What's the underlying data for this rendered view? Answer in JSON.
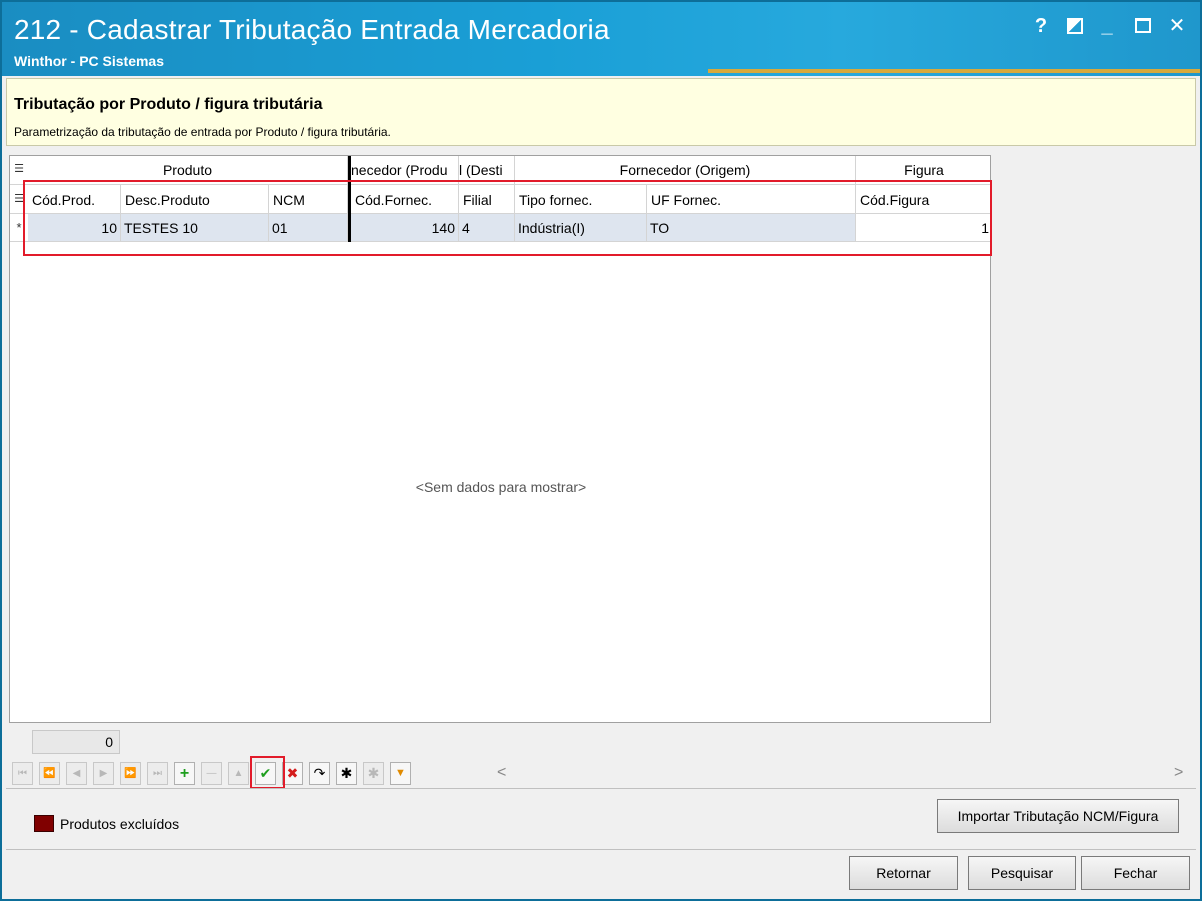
{
  "window": {
    "title": "212 - Cadastrar Tributação Entrada Mercadoria",
    "subtitle": "Winthor - PC Sistemas",
    "controls": {
      "help": "?",
      "minimize": "_",
      "close": "✕"
    }
  },
  "info": {
    "title": "Tributação por Produto / figura tributária",
    "description": "Parametrização da tributação de entrada por Produto / figura tributária."
  },
  "grid": {
    "bands": [
      "Produto",
      "necedor (Produ",
      "l (Desti",
      "Fornecedor (Origem)",
      "Figura"
    ],
    "columns": [
      "Cód.Prod.",
      "Desc.Produto",
      "NCM",
      "Cód.Fornec.",
      "Filial",
      "Tipo fornec.",
      "UF Fornec.",
      "Cód.Figura"
    ],
    "row": {
      "indicator": "*",
      "cod_prod": "10",
      "desc_produto": "TESTES 10",
      "ncm": "01",
      "cod_fornec": "140",
      "filial": "4",
      "tipo_fornec": "Indústria(I)",
      "uf_fornec": "TO",
      "cod_figura": "1"
    },
    "empty_message": "<Sem dados para mostrar>",
    "footer_count": "0"
  },
  "navigator": {
    "buttons": [
      "first-page",
      "prev-page",
      "prev",
      "next",
      "next-page",
      "last-page",
      "append",
      "delete",
      "edit",
      "post",
      "cancel",
      "refresh",
      "save-bookmark",
      "goto-bookmark",
      "filter"
    ],
    "glyphs": {
      "first_page": "⏮",
      "prev_page": "⏪",
      "prev": "◀",
      "next": "▶",
      "next_page": "⏩",
      "last_page": "⏭",
      "append": "+",
      "delete": "—",
      "edit": "▲",
      "post": "✔",
      "cancel": "✖",
      "refresh": "↷",
      "save_bookmark": "✱",
      "goto_bookmark": "✱",
      "filter": "▼",
      "scroll_left": "<",
      "scroll_right": ">"
    }
  },
  "legend": {
    "label": "Produtos excluídos",
    "color": "#800000"
  },
  "buttons": {
    "import": "Importar Tributação NCM/Figura",
    "return": "Retornar",
    "search": "Pesquisar",
    "close": "Fechar"
  },
  "colors": {
    "accent": "#1a9fd6",
    "highlight": "#e21b2a",
    "info_bg": "#ffffe1"
  }
}
